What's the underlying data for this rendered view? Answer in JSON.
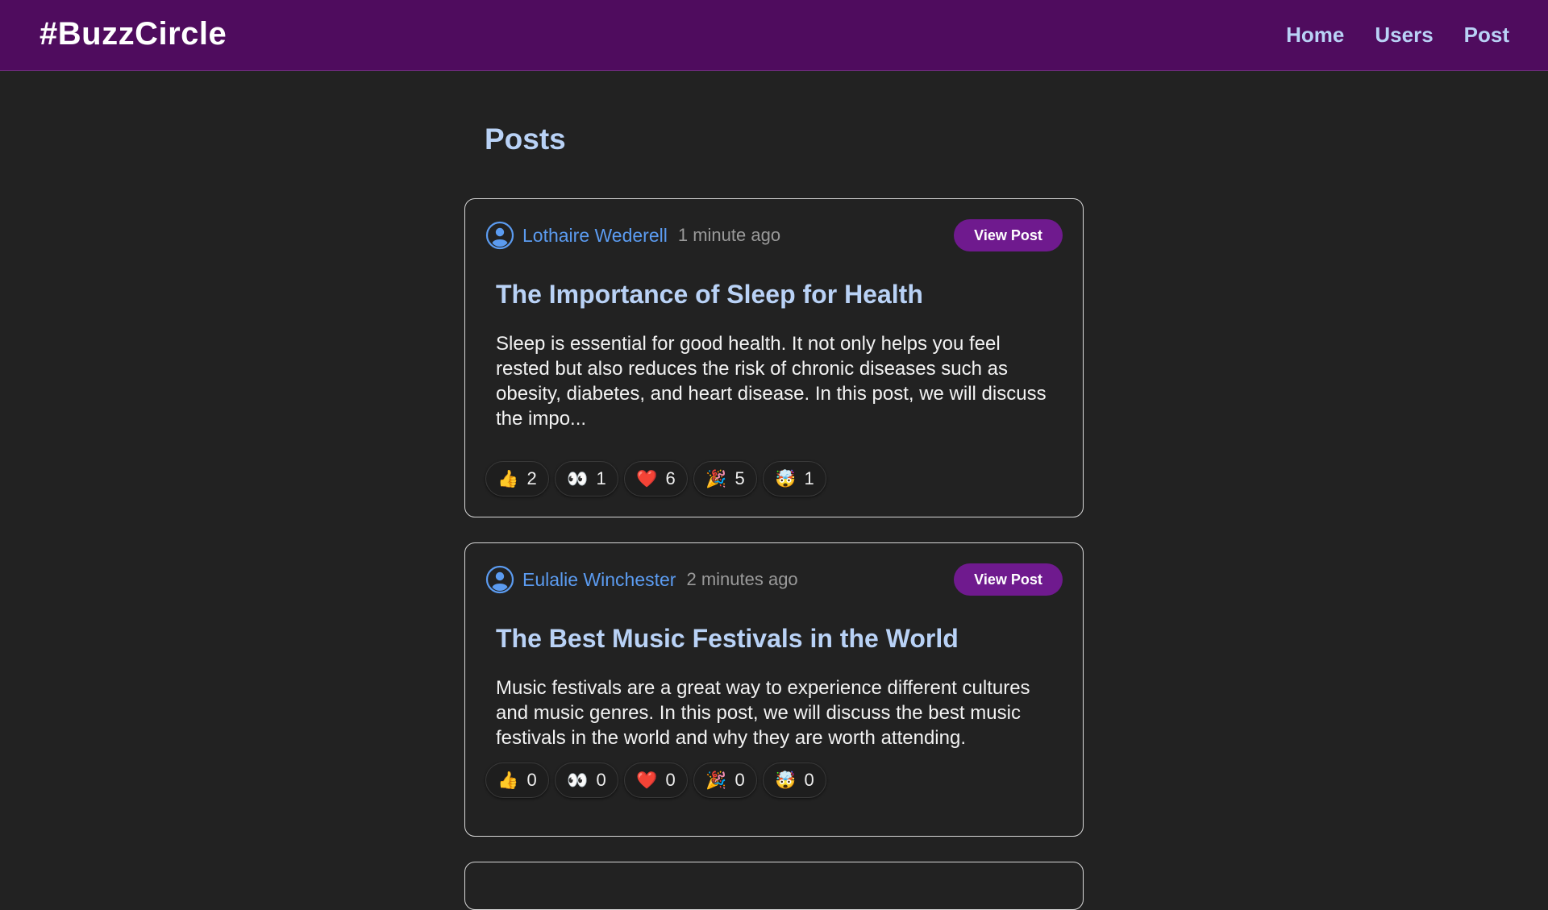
{
  "app": {
    "brand": "#BuzzCircle"
  },
  "nav": {
    "links": [
      "Home",
      "Users",
      "Post"
    ]
  },
  "page": {
    "title": "Posts"
  },
  "icons": {
    "user": "user-circle-icon"
  },
  "colors": {
    "navbar": "#4f0c5e",
    "accent": "#6f1a8e",
    "author_link": "#5b9bf0",
    "title": "#b9d2f6",
    "background": "#222222"
  },
  "posts": [
    {
      "author": "Lothaire Wederell",
      "time": "1 minute ago",
      "view_label": "View Post",
      "title": "The Importance of Sleep for Health",
      "excerpt": "Sleep is essential for good health. It not only helps you feel rested but also reduces the risk of chronic diseases such as obesity, diabetes, and heart disease. In this post, we will discuss the impo...",
      "reactions": [
        {
          "emoji": "👍",
          "icon": "thumbs-up-icon",
          "count": "2"
        },
        {
          "emoji": "👀",
          "icon": "eyes-icon",
          "count": "1"
        },
        {
          "emoji": "❤️",
          "icon": "heart-icon",
          "count": "6"
        },
        {
          "emoji": "🎉",
          "icon": "party-popper-icon",
          "count": "5"
        },
        {
          "emoji": "🤯",
          "icon": "mind-blown-icon",
          "count": "1"
        }
      ]
    },
    {
      "author": "Eulalie Winchester",
      "time": "2 minutes ago",
      "view_label": "View Post",
      "title": "The Best Music Festivals in the World",
      "excerpt": "Music festivals are a great way to experience different cultures and music genres. In this post, we will discuss the best music festivals in the world and why they are worth attending.",
      "reactions": [
        {
          "emoji": "👍",
          "icon": "thumbs-up-icon",
          "count": "0"
        },
        {
          "emoji": "👀",
          "icon": "eyes-icon",
          "count": "0"
        },
        {
          "emoji": "❤️",
          "icon": "heart-icon",
          "count": "0"
        },
        {
          "emoji": "🎉",
          "icon": "party-popper-icon",
          "count": "0"
        },
        {
          "emoji": "🤯",
          "icon": "mind-blown-icon",
          "count": "0"
        }
      ]
    }
  ]
}
